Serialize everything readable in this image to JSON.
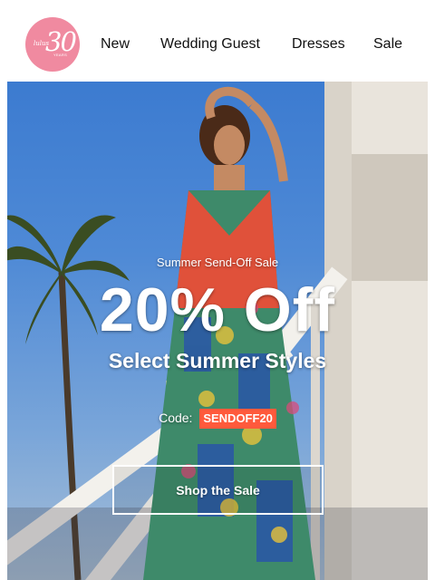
{
  "logo": {
    "brand": "lulus",
    "anniversary": "30",
    "years_label": "YEARS",
    "color": "#f08aa0"
  },
  "nav": {
    "items": [
      {
        "label": "New"
      },
      {
        "label": "Wedding Guest"
      },
      {
        "label": "Dresses"
      },
      {
        "label": "Sale"
      }
    ]
  },
  "hero": {
    "eyebrow": "Summer Send-Off Sale",
    "headline": "20% Off",
    "subhead": "Select Summer Styles",
    "code_label": "Code:",
    "code": "SENDOFF20",
    "cta": "Shop the Sale",
    "accent_color": "#ff5a3c",
    "sky_color": "#3c7bd0"
  }
}
